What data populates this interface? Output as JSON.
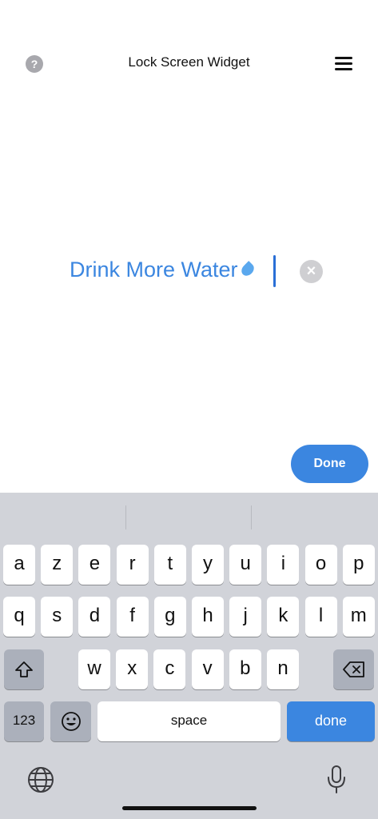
{
  "header": {
    "title": "Lock Screen Widget",
    "help_icon": "?"
  },
  "editor": {
    "text": "Drink More Water",
    "emoji": "droplet-emoji",
    "clear_icon": "×"
  },
  "done_button": "Done",
  "keyboard": {
    "row1": [
      "a",
      "z",
      "e",
      "r",
      "t",
      "y",
      "u",
      "i",
      "o",
      "p"
    ],
    "row2": [
      "q",
      "s",
      "d",
      "f",
      "g",
      "h",
      "j",
      "k",
      "l",
      "m"
    ],
    "row3": [
      "w",
      "x",
      "c",
      "v",
      "b",
      "n"
    ],
    "numbers_label": "123",
    "space_label": "space",
    "done_label": "done",
    "accent_color": "#3b86e0"
  }
}
